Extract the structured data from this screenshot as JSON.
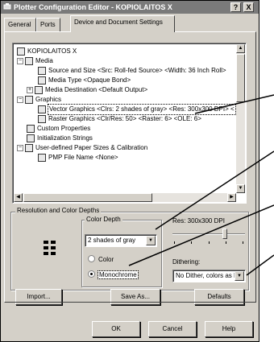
{
  "window": {
    "title": "Plotter Configuration Editor - KOPIOLAITOS X",
    "help_btn": "?",
    "close_btn": "X"
  },
  "tabs": [
    {
      "label": "General"
    },
    {
      "label": "Ports"
    },
    {
      "label": "Device and Document Settings"
    }
  ],
  "tree": {
    "items": [
      {
        "label": "KOPIOLAITOS X"
      },
      {
        "label": "Media"
      },
      {
        "label": "Source and Size <Src:  Roll-fed Source> <Width: 36 Inch Roll>"
      },
      {
        "label": "Media Type <Opaque Bond>"
      },
      {
        "label": "Media Destination <Default Output>"
      },
      {
        "label": "Graphics"
      },
      {
        "label": "Vector Graphics <Clrs: 2 shades of gray> <Res: 300x300 DPI> <"
      },
      {
        "label": "Raster Graphics <Clr/Res: 50> <Raster: 6> <OLE: 6>"
      },
      {
        "label": "Custom Properties"
      },
      {
        "label": "Initialization Strings"
      },
      {
        "label": "User-defined Paper Sizes & Calibration"
      },
      {
        "label": "PMP File Name <None>"
      }
    ]
  },
  "resolution": {
    "group_label": "Resolution and Color Depths",
    "color_depth_label": "Color Depth",
    "color_depth_value": "2 shades of gray",
    "color_radio": "Color",
    "mono_radio": "Monochrome",
    "res_label": "Res: 300x300 DPI",
    "slider_level": 0.72,
    "dithering_label": "Dithering:",
    "dithering_value": "No Dither, colors as B"
  },
  "buttons": {
    "import": "Import...",
    "save_as": "Save As...",
    "defaults": "Defaults",
    "ok": "OK",
    "cancel": "Cancel",
    "help": "Help"
  }
}
